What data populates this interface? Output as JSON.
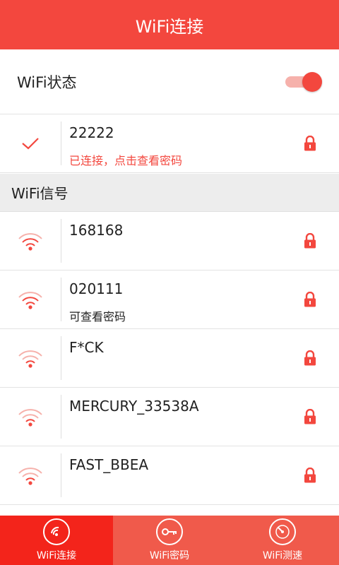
{
  "header": {
    "title": "WiFi连接"
  },
  "wifi_status": {
    "label": "WiFi状态",
    "enabled": true
  },
  "connected": {
    "ssid": "22222",
    "status": "已连接，点击查看密码"
  },
  "section": {
    "title": "WiFi信号"
  },
  "networks": [
    {
      "ssid": "168168",
      "sub": ""
    },
    {
      "ssid": "020111",
      "sub": "可查看密码"
    },
    {
      "ssid": "F*CK",
      "sub": ""
    },
    {
      "ssid": "MERCURY_33538A",
      "sub": ""
    },
    {
      "ssid": "FAST_BBEA",
      "sub": ""
    }
  ],
  "nav": {
    "tabs": [
      {
        "label": "WiFi连接",
        "icon": "wifi-icon"
      },
      {
        "label": "WiFi密码",
        "icon": "key-icon"
      },
      {
        "label": "WiFi测速",
        "icon": "speedometer-icon"
      }
    ]
  },
  "colors": {
    "accent": "#f3473e",
    "nav_active": "#f3241b",
    "nav_bg": "#f05a4b"
  }
}
